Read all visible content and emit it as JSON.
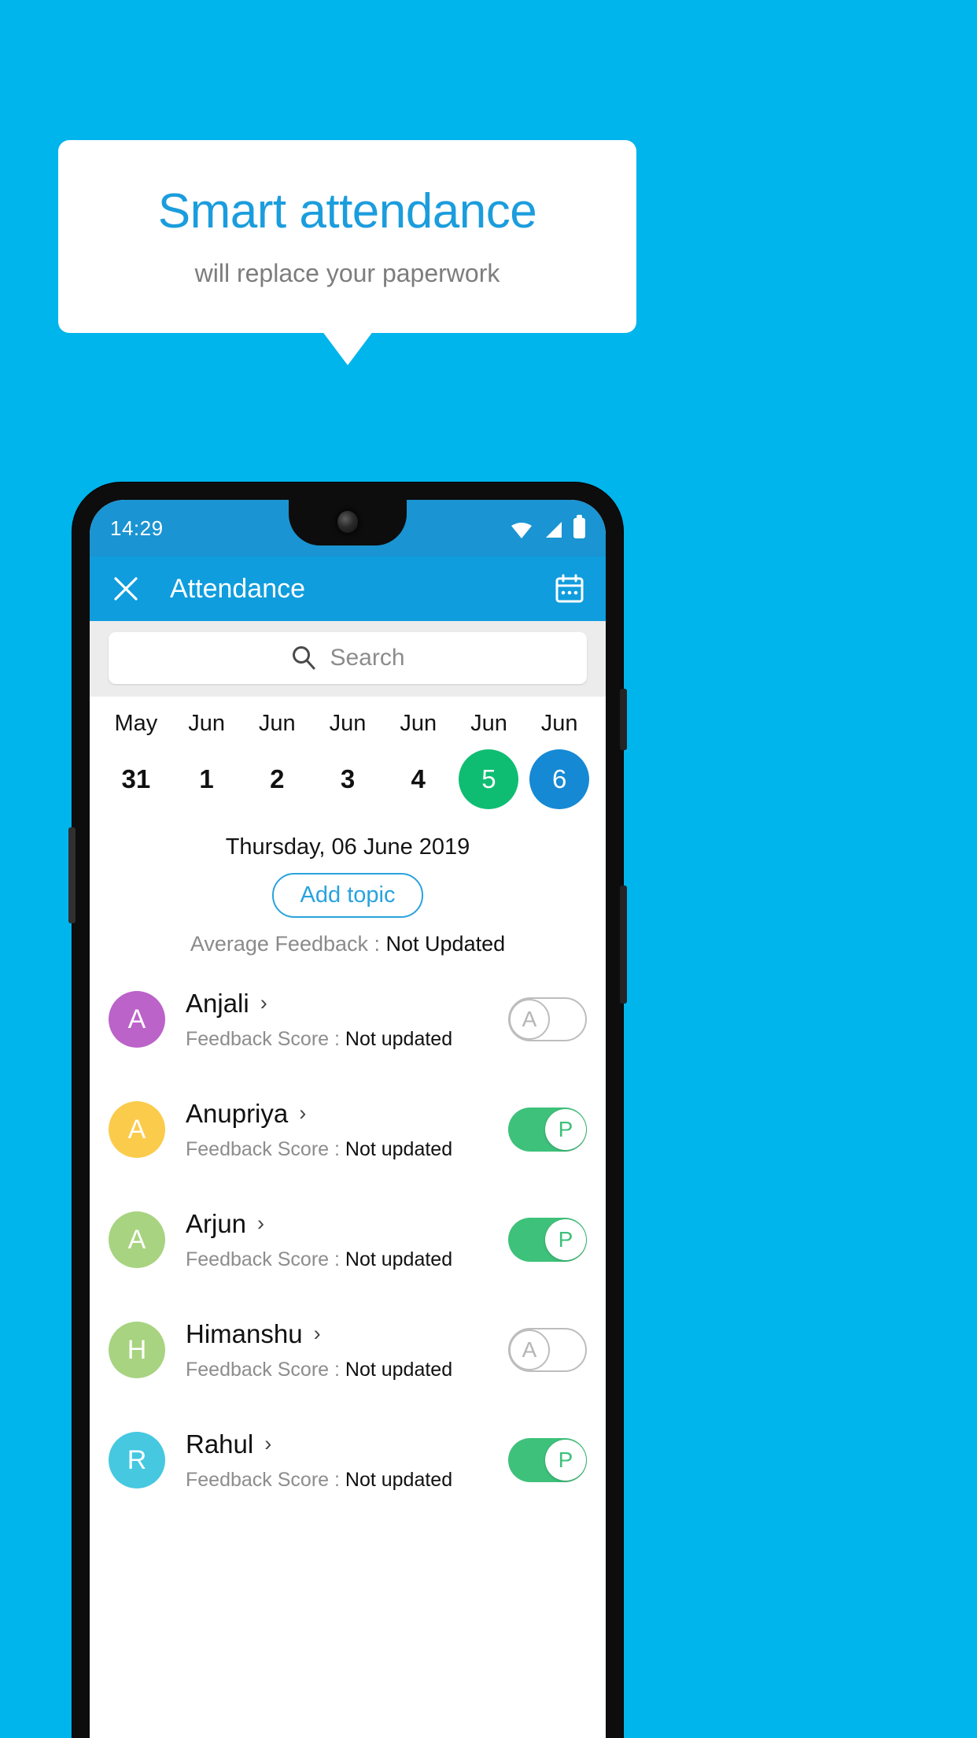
{
  "promo": {
    "title": "Smart attendance",
    "subtitle": "will replace your paperwork"
  },
  "colors": {
    "background": "#00b4ec",
    "accent": "#1b9ddd",
    "appbar": "#0f9ddd",
    "statusbar": "#1a94d2",
    "present_green": "#3ec17a",
    "today_green": "#0fbd72",
    "selected_blue": "#1689d4"
  },
  "statusbar": {
    "time": "14:29",
    "icons": [
      "wifi-icon",
      "signal-icon",
      "battery-icon"
    ]
  },
  "appbar": {
    "close_icon": "close-icon",
    "title": "Attendance",
    "calendar_icon": "calendar-icon"
  },
  "search": {
    "icon": "search-icon",
    "placeholder": "Search",
    "value": ""
  },
  "date_strip": [
    {
      "month": "May",
      "day": "31",
      "state": "normal"
    },
    {
      "month": "Jun",
      "day": "1",
      "state": "normal"
    },
    {
      "month": "Jun",
      "day": "2",
      "state": "normal"
    },
    {
      "month": "Jun",
      "day": "3",
      "state": "normal"
    },
    {
      "month": "Jun",
      "day": "4",
      "state": "normal"
    },
    {
      "month": "Jun",
      "day": "5",
      "state": "today"
    },
    {
      "month": "Jun",
      "day": "6",
      "state": "selected"
    }
  ],
  "selected_day": {
    "label": "Thursday, 06 June 2019",
    "add_topic_label": "Add topic",
    "avg_feedback_label": "Average Feedback : ",
    "avg_feedback_value": "Not Updated"
  },
  "list": {
    "feedback_label": "Feedback Score : ",
    "chevron_icon": "chevron-right-icon",
    "students": [
      {
        "name": "Anjali",
        "initial": "A",
        "avatar_color": "#bb63c9",
        "feedback": "Not updated",
        "status": "A",
        "present": false
      },
      {
        "name": "Anupriya",
        "initial": "A",
        "avatar_color": "#fbcb4b",
        "feedback": "Not updated",
        "status": "P",
        "present": true
      },
      {
        "name": "Arjun",
        "initial": "A",
        "avatar_color": "#a8d380",
        "feedback": "Not updated",
        "status": "P",
        "present": true
      },
      {
        "name": "Himanshu",
        "initial": "H",
        "avatar_color": "#a8d380",
        "feedback": "Not updated",
        "status": "A",
        "present": false
      },
      {
        "name": "Rahul",
        "initial": "R",
        "avatar_color": "#45c8e0",
        "feedback": "Not updated",
        "status": "P",
        "present": true
      }
    ]
  }
}
